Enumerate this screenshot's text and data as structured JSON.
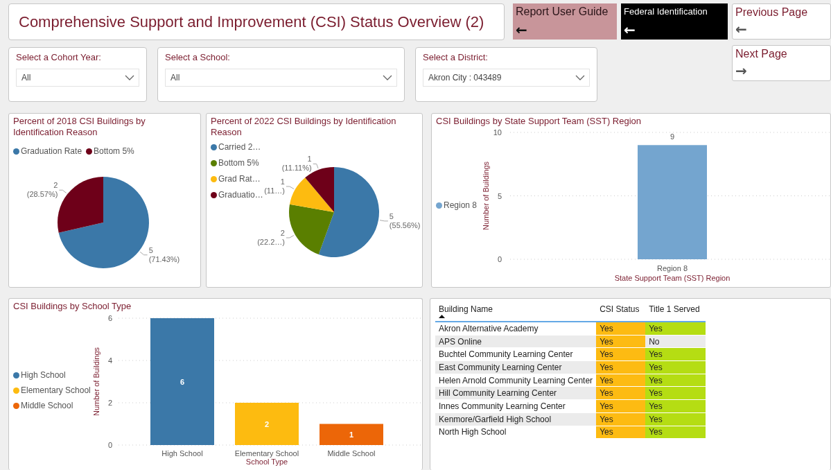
{
  "header": {
    "title": "Comprehensive Support and Improvement (CSI) Status Overview (2)"
  },
  "nav_buttons": [
    {
      "label": "Report User Guide",
      "kind": "pink",
      "icon": "←"
    },
    {
      "label": "Federal Identification",
      "kind": "dark",
      "icon": "←"
    },
    {
      "label": "Previous Page",
      "kind": "plain",
      "icon": "←"
    }
  ],
  "filters": [
    {
      "label": "Select a Cohort Year:",
      "value": "All"
    },
    {
      "label": "Select a School:",
      "value": "All"
    },
    {
      "label": "Select a District:",
      "value": "Akron City : 043489"
    }
  ],
  "next_button": {
    "label": "Next Page",
    "kind": "plain",
    "icon": "→"
  },
  "charts": [
    {
      "legend": [
        {
          "color": "#3b78a8"
        },
        {
          "color": "#6e0019"
        }
      ],
      "chart_data": {
        "type": "pie",
        "title": "Percent of 2018 CSI Buildings by Identification Reason",
        "categories": [
          "Graduation Rate",
          "Bottom 5%"
        ],
        "series": [
          {
            "values": [
              71.43,
              28.57
            ]
          }
        ],
        "value_labels": [
          "5 (71.43%)",
          "2 (28.57%)"
        ]
      }
    },
    {
      "legend": [
        {
          "color": "#3b78a8"
        },
        {
          "color": "#5a7f00"
        },
        {
          "color": "#fdbb10"
        },
        {
          "color": "#6e0019"
        }
      ],
      "chart_data": {
        "type": "pie",
        "title": "Percent of 2022 CSI Buildings by Identification Reason",
        "categories": [
          "Carried 2…",
          "Bottom 5%",
          "Grad Rat…",
          "Graduatio…"
        ],
        "series": [
          {
            "values": [
              55.56,
              22.22,
              11.11,
              11.11
            ]
          }
        ],
        "value_labels": [
          "5 (55.56%)",
          "2 (22.2…)",
          "1 (11…)",
          "1 (11.11%)"
        ]
      }
    },
    {
      "legend": [
        {
          "label": "Region 8",
          "color": "#74a5cf"
        }
      ],
      "chart_data": {
        "type": "bar",
        "title": "CSI Buildings by State Support Team (SST) Region",
        "xlabel": "State Support Team (SST) Region",
        "ylabel": "Number of Buildings",
        "categories": [
          "Region 8"
        ],
        "series": [
          {
            "values": [
              9
            ]
          }
        ],
        "ylim": [
          0,
          10
        ],
        "yticks": [
          0,
          5,
          10
        ],
        "data_labels": true
      }
    },
    {
      "legend": [
        {
          "label": "High School",
          "color": "#3b78a8"
        },
        {
          "label": "Elementary School",
          "color": "#fdbb10"
        },
        {
          "label": "Middle School",
          "color": "#ec6608"
        }
      ],
      "chart_data": {
        "type": "bar",
        "title": "CSI Buildings by School Type",
        "xlabel": "School Type",
        "ylabel": "Number of Buildings",
        "categories": [
          "High School",
          "Elementary School",
          "Middle School"
        ],
        "series": [
          {
            "values": [
              6,
              2,
              1
            ]
          }
        ],
        "ylim": [
          0,
          6
        ],
        "yticks": [
          0,
          2,
          4,
          6
        ],
        "data_labels": true
      }
    }
  ],
  "table": {
    "columns": [
      {
        "label": "Building Name",
        "sorted": true
      },
      {
        "label": "CSI Status",
        "sorted": false
      },
      {
        "label": "Title 1 Served",
        "sorted": false
      }
    ],
    "rows": [
      {
        "cells": [
          {
            "text": "Akron Alternative Academy"
          },
          {
            "text": "Yes",
            "color": "#fdbb12"
          },
          {
            "text": "Yes",
            "color": "#b5dd13"
          }
        ]
      },
      {
        "cells": [
          {
            "text": "APS Online"
          },
          {
            "text": "Yes",
            "color": "#fdbb12"
          },
          {
            "text": "No"
          }
        ]
      },
      {
        "cells": [
          {
            "text": "Buchtel Community Learning Center"
          },
          {
            "text": "Yes",
            "color": "#fdbb12"
          },
          {
            "text": "Yes",
            "color": "#b5dd13"
          }
        ]
      },
      {
        "cells": [
          {
            "text": "East Community Learning Center"
          },
          {
            "text": "Yes",
            "color": "#fdbb12"
          },
          {
            "text": "Yes",
            "color": "#b5dd13"
          }
        ]
      },
      {
        "cells": [
          {
            "text": "Helen Arnold Community Learning Center"
          },
          {
            "text": "Yes",
            "color": "#fdbb12"
          },
          {
            "text": "Yes",
            "color": "#b5dd13"
          }
        ]
      },
      {
        "cells": [
          {
            "text": "Hill Community Learning Center"
          },
          {
            "text": "Yes",
            "color": "#fdbb12"
          },
          {
            "text": "Yes",
            "color": "#b5dd13"
          }
        ]
      },
      {
        "cells": [
          {
            "text": "Innes Community Learning Center"
          },
          {
            "text": "Yes",
            "color": "#fdbb12"
          },
          {
            "text": "Yes",
            "color": "#b5dd13"
          }
        ]
      },
      {
        "cells": [
          {
            "text": "Kenmore/Garfield High School"
          },
          {
            "text": "Yes",
            "color": "#fdbb12"
          },
          {
            "text": "Yes",
            "color": "#b5dd13"
          }
        ]
      },
      {
        "cells": [
          {
            "text": "North High School"
          },
          {
            "text": "Yes",
            "color": "#fdbb12"
          },
          {
            "text": "Yes",
            "color": "#b5dd13"
          }
        ]
      }
    ]
  }
}
